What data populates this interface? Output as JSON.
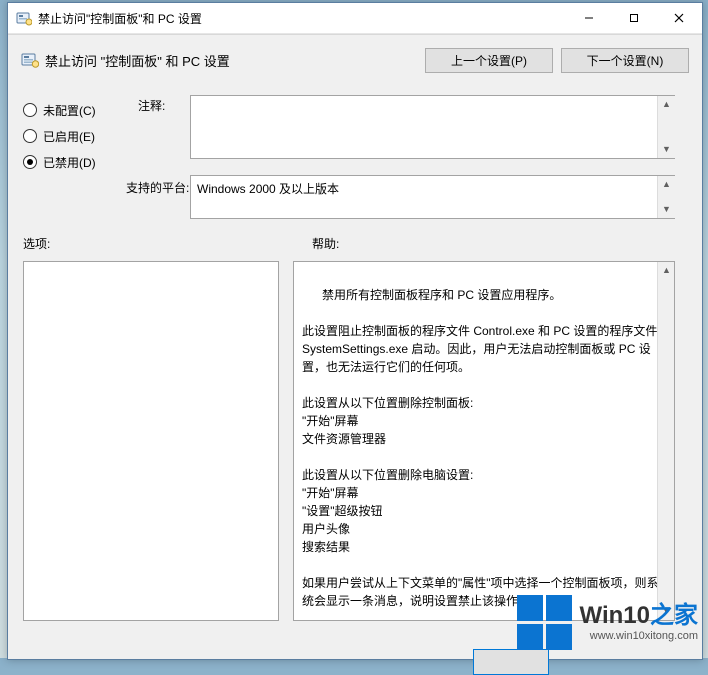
{
  "window": {
    "title": "禁止访问\"控制面板\"和 PC 设置"
  },
  "header": {
    "title": "禁止访问 \"控制面板\" 和 PC 设置",
    "prev_button": "上一个设置(P)",
    "next_button": "下一个设置(N)"
  },
  "radios": {
    "not_configured": "未配置(C)",
    "enabled": "已启用(E)",
    "disabled": "已禁用(D)",
    "selected": "disabled"
  },
  "labels": {
    "comment": "注释:",
    "platform": "支持的平台:",
    "options": "选项:",
    "help": "帮助:"
  },
  "fields": {
    "comment": "",
    "platform": "Windows 2000 及以上版本"
  },
  "help_text": "禁用所有控制面板程序和 PC 设置应用程序。\n\n此设置阻止控制面板的程序文件 Control.exe 和 PC 设置的程序文件 SystemSettings.exe 启动。因此，用户无法启动控制面板或 PC 设置，也无法运行它们的任何项。\n\n此设置从以下位置删除控制面板:\n\"开始\"屏幕\n文件资源管理器\n\n此设置从以下位置删除电脑设置:\n\"开始\"屏幕\n\"设置\"超级按钮\n用户头像\n搜索结果\n\n如果用户尝试从上下文菜单的\"属性\"项中选择一个控制面板项，则系统会显示一条消息，说明设置禁止该操作。",
  "watermark": {
    "brand_a": "Win10",
    "brand_b": "之家",
    "url": "www.win10xitong.com"
  }
}
